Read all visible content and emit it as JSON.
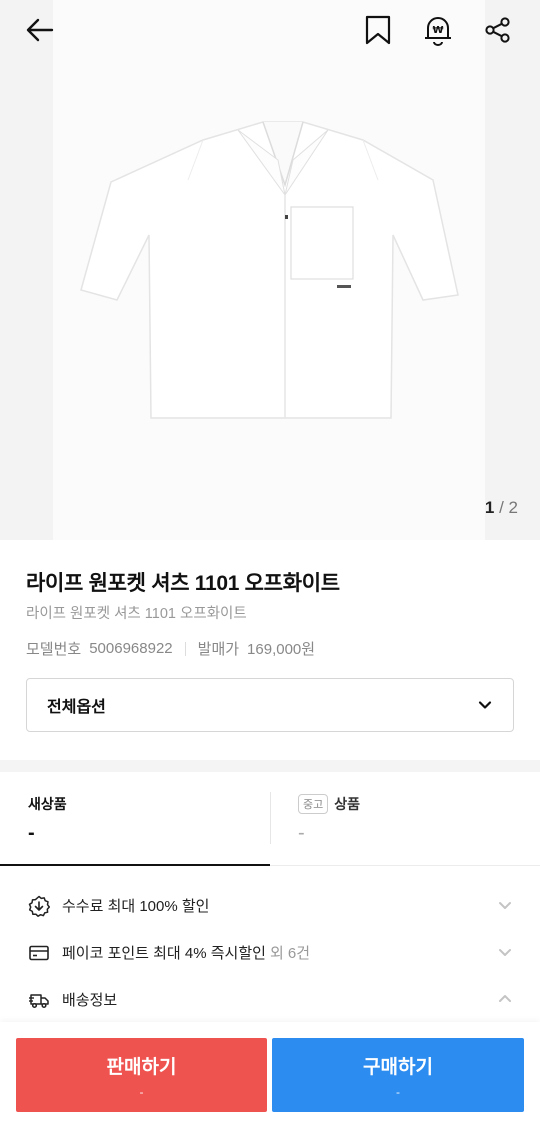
{
  "header": {
    "icons": [
      "arrow-left-icon",
      "bookmark-icon",
      "price-alert-icon",
      "share-icon"
    ]
  },
  "gallery": {
    "current": "1",
    "separator": "/",
    "total": "2"
  },
  "product": {
    "title": "라이프 원포켓 셔츠 1101 오프화이트",
    "subtitle": "라이프 원포켓 셔츠 1101 오프화이트",
    "model_label": "모델번호",
    "model_value": "5006968922",
    "release_label": "발매가",
    "release_value": "169,000원"
  },
  "option": {
    "label": "전체옵션"
  },
  "tabs": {
    "new_label": "새상품",
    "new_price": "-",
    "used_badge": "중고",
    "used_label": "상품",
    "used_price": "-"
  },
  "benefits": [
    {
      "icon": "discount-icon",
      "text": "수수료 최대 100% 할인",
      "extra": ""
    },
    {
      "icon": "card-icon",
      "text": "페이코 포인트 최대 4% 즉시할인",
      "extra": "외 6건"
    },
    {
      "icon": "delivery-truck-icon",
      "text": "배송정보",
      "extra": ""
    }
  ],
  "actions": {
    "sell_label": "판매하기",
    "sell_price": "-",
    "buy_label": "구매하기",
    "buy_price": "-"
  },
  "colors": {
    "sell": "#ef5350",
    "buy": "#2d8cf0"
  }
}
